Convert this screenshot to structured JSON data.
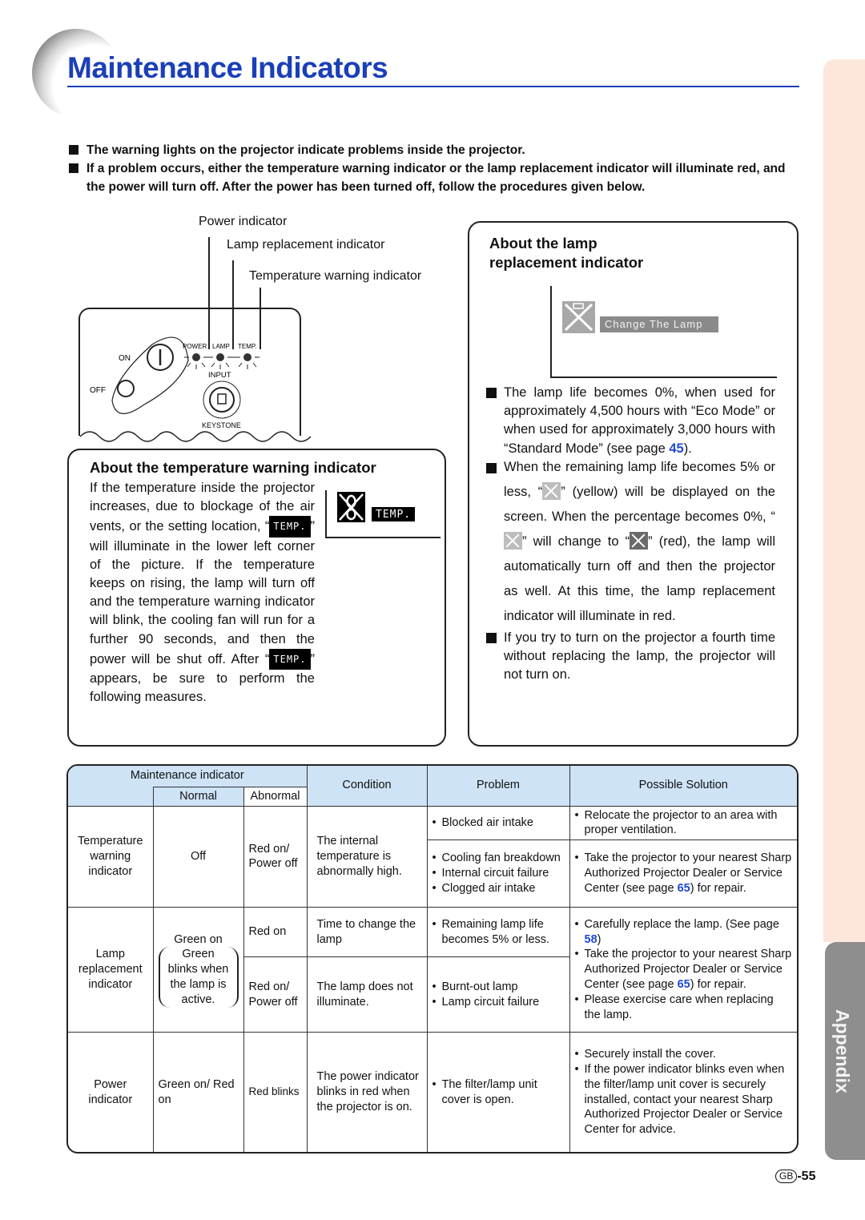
{
  "header": {
    "title": "Maintenance Indicators"
  },
  "side_tab": {
    "label": "Appendix"
  },
  "intro": [
    "The warning lights on the projector indicate problems inside the projector.",
    "If a problem occurs, either the temperature warning indicator or the lamp replacement indicator will illuminate red, and the power will turn off. After the power has been turned off, follow the procedures given below."
  ],
  "diagram": {
    "callouts": {
      "power": "Power indicator",
      "lamp": "Lamp replacement indicator",
      "temp": "Temperature warning indicator"
    },
    "panel_labels": {
      "on": "ON",
      "off": "OFF",
      "power": "POWER",
      "lamp": "LAMP",
      "temp": "TEMP.",
      "input": "INPUT",
      "keystone": "KEYSTONE"
    }
  },
  "temp_box": {
    "title": "About the temperature warning indicator",
    "osd_label": "TEMP.",
    "p1_a": "If the temperature inside the projector increases, due to blockage of the air vents, or the setting location, “",
    "p1_b": "” will illuminate in the lower left corner of the picture. If the temperature keeps on rising, the lamp will turn off and the temperature warning indicator will blink, the cooling fan will run for a further 90 seconds, and then the power will be shut off. After “",
    "p1_c": "” appears, be sure to perform the following measures."
  },
  "lamp_box": {
    "title_line1": "About the lamp",
    "title_line2": "replacement indicator",
    "osd_label": "Change The Lamp",
    "b1_a": "The lamp life becomes 0%, when used for approximately 4,500 hours with “Eco Mode” or when used for approximately 3,000 hours with “Standard Mode” (see page ",
    "b1_link": "45",
    "b1_b": ").",
    "b2_a": "When the remaining lamp life becomes 5% or less, “",
    "b2_b": "” (yellow) will be displayed on the screen. When the percentage becomes 0%, “",
    "b2_c": "” will change to “",
    "b2_d": "” (red), the lamp will automatically turn off and then the projector as well. At this time, the lamp replacement indicator will illuminate in red.",
    "b3": "If you try to turn on the projector a fourth time without replacing the lamp, the projector will not turn on."
  },
  "table": {
    "headers": {
      "maint": "Maintenance indicator",
      "normal": "Normal",
      "abnormal": "Abnormal",
      "condition": "Condition",
      "problem": "Problem",
      "solution": "Possible Solution"
    },
    "temp": {
      "indicator": "Temperature warning indicator",
      "normal": "Off",
      "abnormal": "Red on/ Power off",
      "condition": "The internal temperature is abnormally high.",
      "problem1": "Blocked air intake",
      "solution1": "Relocate the projector to an area with proper ventilation.",
      "problem2": [
        "Cooling fan breakdown",
        "Internal circuit failure",
        "Clogged air intake"
      ],
      "solution2_a": "Take the projector to your nearest Sharp Authorized Projector Dealer or Service Center (see page ",
      "solution2_link": "65",
      "solution2_b": ") for repair."
    },
    "lamp": {
      "indicator": "Lamp replacement indicator",
      "normal_a": "Green on",
      "normal_b": "Green blinks when the lamp is active.",
      "abnormal1": "Red on",
      "condition1": "Time to change the lamp",
      "problem1": "Remaining lamp life becomes 5% or less.",
      "abnormal2": "Red on/ Power off",
      "condition2": "The lamp does not illuminate.",
      "problem2": [
        "Burnt-out lamp",
        "Lamp circuit failure"
      ],
      "solution1_a": "Carefully replace the lamp. (See page ",
      "solution1_link": "58",
      "solution1_b": ")",
      "solution2_a": "Take the projector to your nearest Sharp Authorized Projector Dealer or Service Center (see page ",
      "solution2_link": "65",
      "solution2_b": ") for repair.",
      "solution3": "Please exercise care when replacing the lamp."
    },
    "power": {
      "indicator": "Power indicator",
      "normal": "Green on/ Red on",
      "abnormal": "Red blinks",
      "condition": "The power indicator blinks in red when the projector is on.",
      "problem": "The filter/lamp unit cover is open.",
      "solution1": "Securely install the cover.",
      "solution2": "If the power indicator blinks even when the filter/lamp unit cover is securely installed, contact your nearest Sharp Authorized Projector Dealer or Service Center for advice."
    }
  },
  "footer": {
    "region": "GB",
    "page": "-55"
  },
  "colors": {
    "title_blue": "#1a3fb8",
    "link_blue": "#1f49d6",
    "table_header": "#cfe3f6",
    "tab_pink": "#fde6dc",
    "tab_gray": "#8e8e8e"
  }
}
